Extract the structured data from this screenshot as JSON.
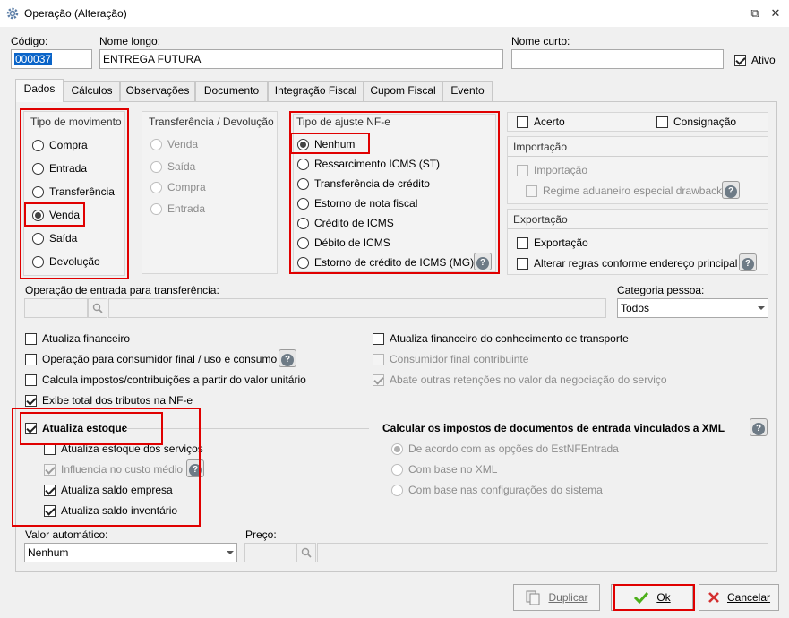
{
  "window": {
    "title": "Operação (Alteração)",
    "restore_glyph": "⧉",
    "close_glyph": "✕"
  },
  "header": {
    "codigo_label": "Código:",
    "codigo_value": "000037",
    "nome_longo_label": "Nome longo:",
    "nome_longo_value": "ENTREGA FUTURA",
    "nome_curto_label": "Nome curto:",
    "nome_curto_value": "",
    "ativo_label": "Ativo"
  },
  "tabs": [
    "Dados",
    "Cálculos",
    "Observações",
    "Documento",
    "Integração Fiscal",
    "Cupom Fiscal",
    "Evento"
  ],
  "tipo_movimento": {
    "title": "Tipo de movimento",
    "options": [
      "Compra",
      "Entrada",
      "Transferência",
      "Venda",
      "Saída",
      "Devolução"
    ],
    "selected": "Venda"
  },
  "transferencia_devolucao": {
    "title": "Transferência / Devolução",
    "options": [
      "Venda",
      "Saída",
      "Compra",
      "Entrada"
    ]
  },
  "tipo_ajuste": {
    "title": "Tipo de ajuste NF-e",
    "options": [
      "Nenhum",
      "Ressarcimento ICMS (ST)",
      "Transferência de crédito",
      "Estorno de nota fiscal",
      "Crédito de ICMS",
      "Débito de ICMS",
      "Estorno de crédito de ICMS (MG)"
    ],
    "selected": "Nenhum"
  },
  "right_panel": {
    "acerto": "Acerto",
    "consignacao": "Consignação",
    "importacao_title": "Importação",
    "importacao_cb": "Importação",
    "regime": "Regime aduaneiro especial drawback",
    "exportacao_title": "Exportação",
    "exportacao_cb": "Exportação",
    "alterar_regras": "Alterar regras conforme endereço principal"
  },
  "operacao_entrada": {
    "label": "Operação de entrada para transferência:"
  },
  "categoria": {
    "label": "Categoria pessoa:",
    "value": "Todos"
  },
  "left_checks": {
    "atualiza_financeiro": "Atualiza financeiro",
    "consumidor_final": "Operação para consumidor final / uso e consumo",
    "calcula_impostos": "Calcula impostos/contribuições a partir do valor unitário",
    "exibe_total": "Exibe total dos tributos na NF-e"
  },
  "right_checks": {
    "atualiza_fin_transporte": "Atualiza financeiro do conhecimento de transporte",
    "consumidor_contribuinte": "Consumidor final contribuinte",
    "abate_retencoes": "Abate outras retenções no valor da negociação do serviço"
  },
  "estoque": {
    "atualiza_estoque": "Atualiza estoque",
    "servicos": "Atualiza estoque dos serviços",
    "custo_medio": "Influencia no custo médio",
    "saldo_empresa": "Atualiza saldo empresa",
    "saldo_inventario": "Atualiza saldo inventário"
  },
  "xml_section": {
    "title": "Calcular os impostos de documentos de entrada vinculados a XML",
    "options": [
      "De acordo com as opções do EstNFEntrada",
      "Com base no XML",
      "Com base nas configurações do sistema"
    ]
  },
  "valor_automatico": {
    "label": "Valor automático:",
    "value": "Nenhum"
  },
  "preco": {
    "label": "Preço:"
  },
  "buttons": {
    "duplicar": "Duplicar",
    "ok": "Ok",
    "cancelar": "Cancelar"
  },
  "help_glyph": "?",
  "colors": {
    "highlight_red": "#e00000",
    "ok_green": "#4caf1a",
    "cancel_red": "#d32f2f",
    "selection_blue": "#0a64c8"
  }
}
